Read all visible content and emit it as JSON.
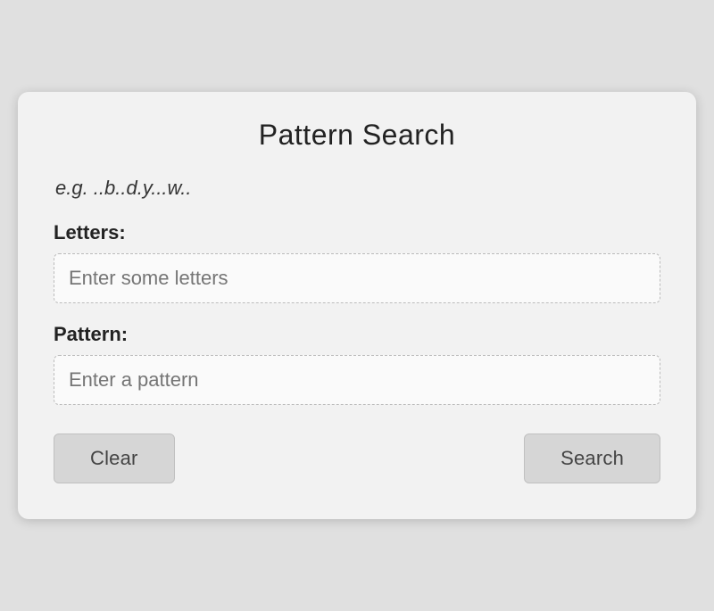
{
  "dialog": {
    "title": "Pattern Search",
    "example": "e.g. ..b..d.y...w..",
    "letters_label": "Letters:",
    "letters_placeholder": "Enter some letters",
    "pattern_label": "Pattern:",
    "pattern_placeholder": "Enter a pattern",
    "clear_button": "Clear",
    "search_button": "Search"
  }
}
